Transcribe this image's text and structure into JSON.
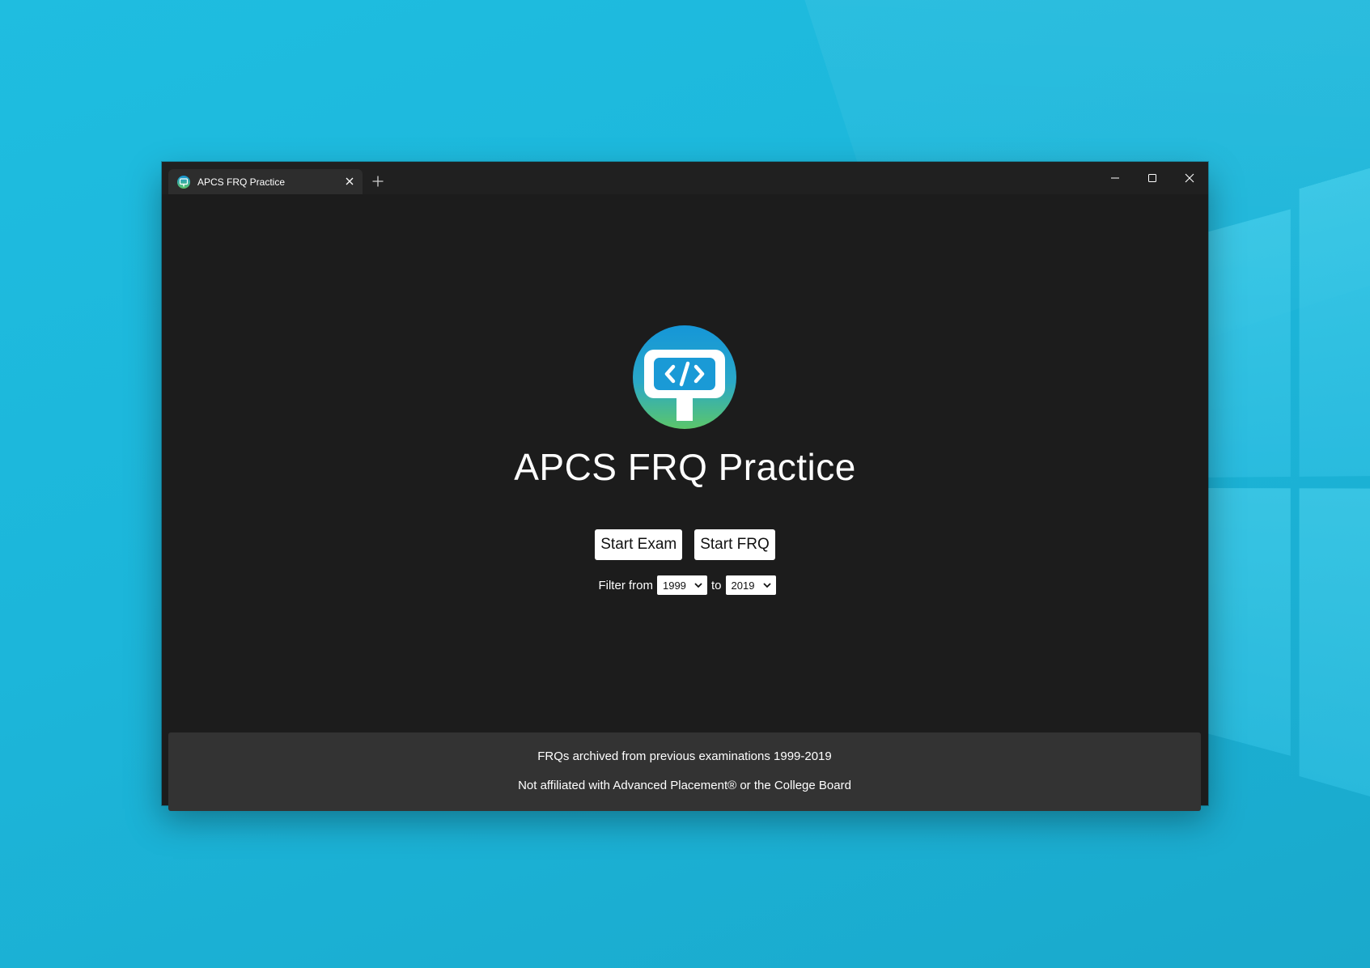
{
  "window": {
    "tab_title": "APCS FRQ Practice",
    "icons": {
      "tab": "app-logo-icon",
      "tab_close": "close-icon",
      "new_tab": "plus-icon",
      "minimize": "minimize-icon",
      "maximize": "maximize-icon",
      "close": "close-icon"
    }
  },
  "main": {
    "title": "APCS FRQ Practice",
    "start_exam_label": "Start Exam",
    "start_frq_label": "Start FRQ",
    "filter": {
      "from_label": "Filter from",
      "from_value": "1999",
      "to_label": "to",
      "to_value": "2019"
    }
  },
  "footer": {
    "line1": "FRQs archived from previous examinations 1999-2019",
    "line2": "Not affiliated with Advanced Placement® or the College Board"
  },
  "colors": {
    "logo_gradient_top": "#1596d8",
    "logo_gradient_bottom": "#5cc66a",
    "window_bg": "#1c1c1c",
    "footer_bg": "#333333",
    "desktop_bg": "#1fbde0"
  }
}
